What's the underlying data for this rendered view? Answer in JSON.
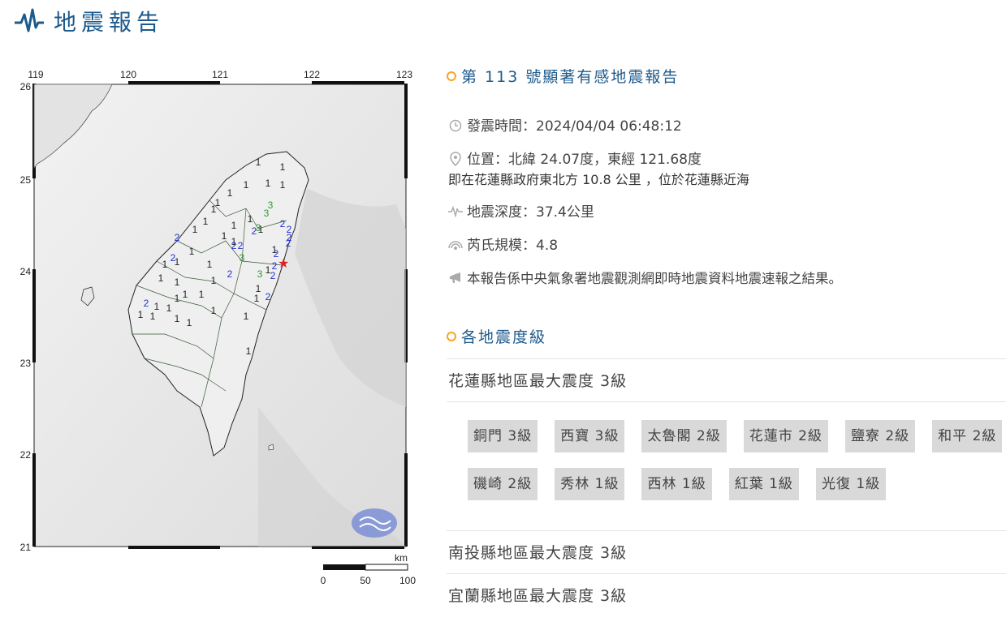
{
  "header": {
    "title": "地震報告"
  },
  "map": {
    "lon_ticks": [
      "119",
      "120",
      "121",
      "122",
      "123"
    ],
    "lat_ticks": [
      "26",
      "25",
      "24",
      "23",
      "22",
      "21"
    ],
    "scale_unit": "km",
    "scale_labels": [
      "0",
      "50",
      "100"
    ],
    "stations": [
      {
        "v": "1",
        "c": "#222"
      },
      {
        "v": "1",
        "c": "#222"
      },
      {
        "v": "1",
        "c": "#222"
      },
      {
        "v": "1",
        "c": "#222"
      },
      {
        "v": "1",
        "c": "#222"
      },
      {
        "v": "1",
        "c": "#222"
      },
      {
        "v": "1",
        "c": "#222"
      },
      {
        "v": "1",
        "c": "#222"
      },
      {
        "v": "1",
        "c": "#222"
      },
      {
        "v": "1",
        "c": "#222"
      },
      {
        "v": "1",
        "c": "#222"
      },
      {
        "v": "1",
        "c": "#222"
      },
      {
        "v": "1",
        "c": "#222"
      },
      {
        "v": "1",
        "c": "#222"
      },
      {
        "v": "1",
        "c": "#222"
      },
      {
        "v": "1",
        "c": "#222"
      },
      {
        "v": "1",
        "c": "#222"
      },
      {
        "v": "1",
        "c": "#222"
      },
      {
        "v": "1",
        "c": "#222"
      },
      {
        "v": "1",
        "c": "#222"
      },
      {
        "v": "1",
        "c": "#222"
      },
      {
        "v": "1",
        "c": "#222"
      },
      {
        "v": "1",
        "c": "#222"
      },
      {
        "v": "1",
        "c": "#222"
      },
      {
        "v": "1",
        "c": "#222"
      },
      {
        "v": "1",
        "c": "#222"
      },
      {
        "v": "1",
        "c": "#222"
      },
      {
        "v": "1",
        "c": "#222"
      },
      {
        "v": "1",
        "c": "#222"
      },
      {
        "v": "1",
        "c": "#222"
      },
      {
        "v": "1",
        "c": "#222"
      },
      {
        "v": "1",
        "c": "#222"
      },
      {
        "v": "1",
        "c": "#222"
      },
      {
        "v": "1",
        "c": "#222"
      },
      {
        "v": "1",
        "c": "#222"
      },
      {
        "v": "1",
        "c": "#222"
      },
      {
        "v": "1",
        "c": "#222"
      },
      {
        "v": "1",
        "c": "#222"
      },
      {
        "v": "2",
        "c": "#2233cc"
      },
      {
        "v": "2",
        "c": "#2233cc"
      },
      {
        "v": "2",
        "c": "#2233cc"
      },
      {
        "v": "2",
        "c": "#2233cc"
      },
      {
        "v": "2",
        "c": "#2233cc"
      },
      {
        "v": "2",
        "c": "#2233cc"
      },
      {
        "v": "2",
        "c": "#2233cc"
      },
      {
        "v": "2",
        "c": "#2233cc"
      },
      {
        "v": "2",
        "c": "#2233cc"
      },
      {
        "v": "2",
        "c": "#2233cc"
      },
      {
        "v": "2",
        "c": "#2233cc"
      },
      {
        "v": "2",
        "c": "#2233cc"
      },
      {
        "v": "2",
        "c": "#2233cc"
      },
      {
        "v": "2",
        "c": "#2233cc"
      },
      {
        "v": "2",
        "c": "#2233cc"
      },
      {
        "v": "3",
        "c": "#2a9d2a"
      },
      {
        "v": "3",
        "c": "#2a9d2a"
      },
      {
        "v": "3",
        "c": "#2a9d2a"
      },
      {
        "v": "3",
        "c": "#2a9d2a"
      },
      {
        "v": "3",
        "c": "#2a9d2a"
      }
    ]
  },
  "report": {
    "title": "第 113 號顯著有感地震報告",
    "time": "發震時間：2024/04/04 06:48:12",
    "location": "位置：北緯 24.07度，東經 121.68度",
    "location_detail": "即在花蓮縣政府東北方 10.8 公里 ，位於花蓮縣近海",
    "depth": "地震深度：37.4公里",
    "magnitude": "芮氏規模：4.8",
    "note": "本報告係中央氣象署地震觀測網即時地震資料地震速報之結果。"
  },
  "intensity": {
    "title": "各地震度級",
    "regions": [
      {
        "label": "花蓮縣地區最大震度 3級",
        "stations": [
          "銅門 3級",
          "西寶 3級",
          "太魯閣 2級",
          "花蓮市 2級",
          "鹽寮 2級",
          "和平 2級",
          "磯崎 2級",
          "秀林 1級",
          "西林 1級",
          "紅葉 1級",
          "光復 1級"
        ]
      },
      {
        "label": "南投縣地區最大震度 3級"
      },
      {
        "label": "宜蘭縣地區最大震度 3級"
      }
    ]
  }
}
